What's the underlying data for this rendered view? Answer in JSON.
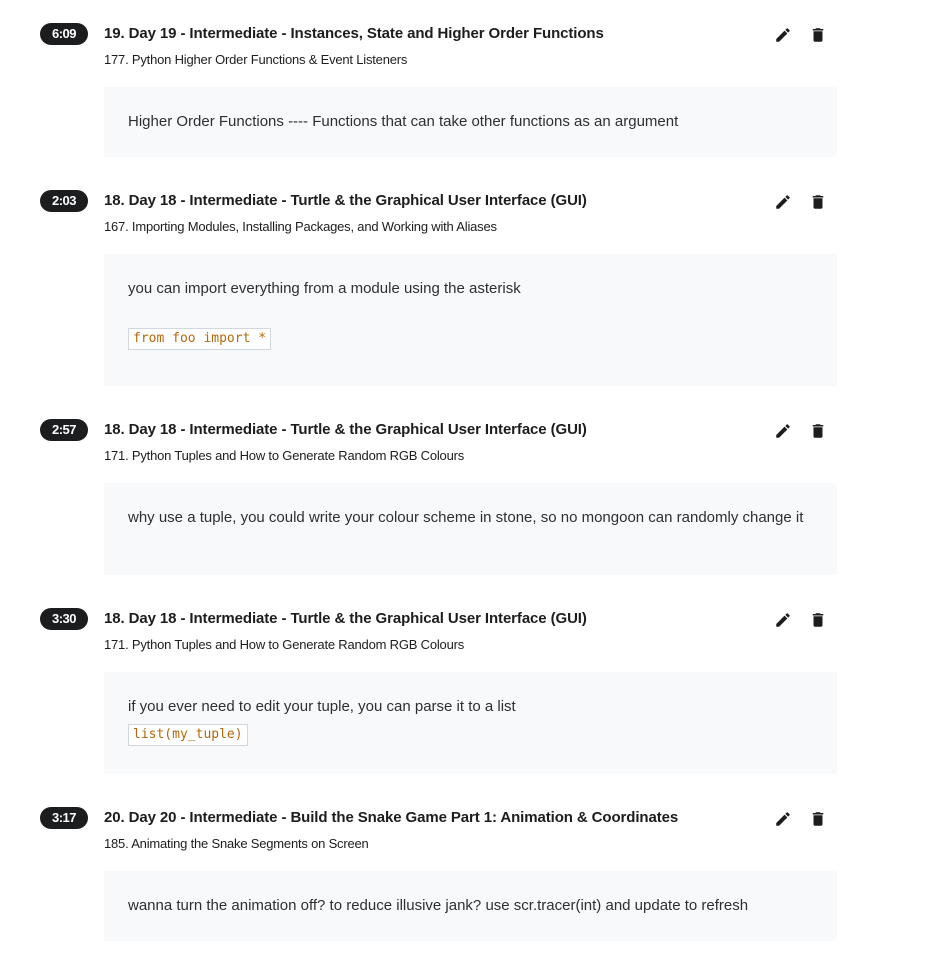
{
  "notes": [
    {
      "timestamp": "6:09",
      "section": "19. Day 19 - Intermediate - Instances, State and Higher Order Functions",
      "lecture": "177. Python Higher Order Functions & Event Listeners",
      "text": "Higher Order Functions ---- Functions that can take other functions as an argument",
      "code": ""
    },
    {
      "timestamp": "2:03",
      "section": "18. Day 18 - Intermediate - Turtle & the Graphical User Interface (GUI)",
      "lecture": "167. Importing Modules, Installing Packages, and Working with Aliases",
      "text": "you can import everything from a module using the asterisk",
      "code": "from foo import *"
    },
    {
      "timestamp": "2:57",
      "section": "18. Day 18 - Intermediate - Turtle & the Graphical User Interface (GUI)",
      "lecture": "171. Python Tuples and How to Generate Random RGB Colours",
      "text": "why use a tuple, you could write your colour scheme in stone, so no mongoon can randomly change it",
      "code": ""
    },
    {
      "timestamp": "3:30",
      "section": "18. Day 18 - Intermediate - Turtle & the Graphical User Interface (GUI)",
      "lecture": "171. Python Tuples and How to Generate Random RGB Colours",
      "text": "if you ever need to edit your tuple, you can parse it to a list",
      "code": "list(my_tuple)"
    },
    {
      "timestamp": "3:17",
      "section": "20. Day 20 - Intermediate - Build the Snake Game Part 1: Animation & Coordinates",
      "lecture": "185. Animating the Snake Segments on Screen",
      "text": "wanna turn the animation off? to reduce illusive jank? use scr.tracer(int) and update to refresh",
      "code": ""
    }
  ],
  "icons": {
    "edit": "pencil-icon",
    "delete": "trash-icon"
  },
  "colors": {
    "badge_bg": "#1c1d1f",
    "note_bg": "#f7f9fa",
    "code_text": "#b4690e"
  }
}
